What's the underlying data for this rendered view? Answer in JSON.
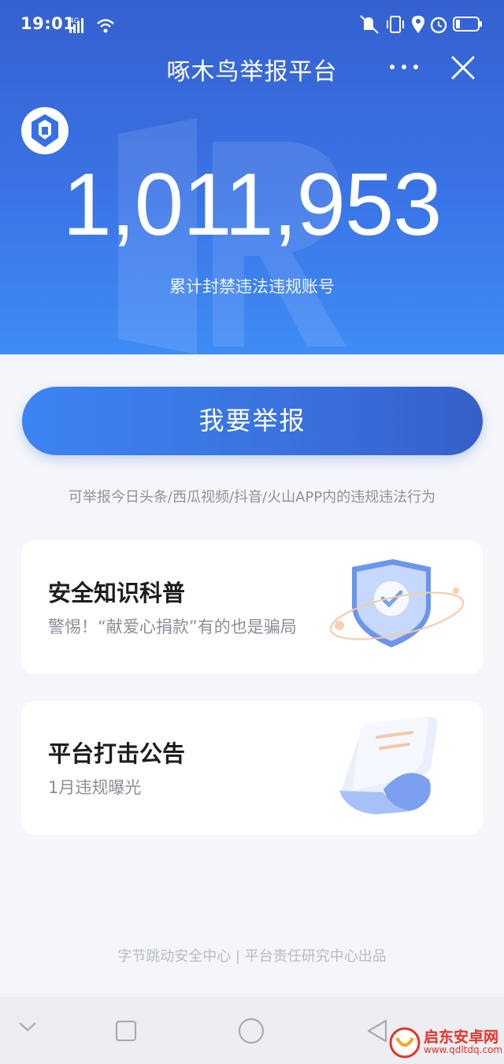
{
  "status_bar": {
    "time": "19:01",
    "network": "4G",
    "icons_left": [
      "signal-icon",
      "wifi-icon"
    ],
    "icons_right": [
      "mute-icon",
      "vibrate-icon",
      "location-icon",
      "alarm-icon",
      "battery-icon"
    ]
  },
  "header": {
    "title": "啄木鸟举报平台",
    "more_icon": "more-dots-icon",
    "close_icon": "close-icon"
  },
  "hero": {
    "count": "1,011,953",
    "count_label": "累计封禁违法违规账号"
  },
  "report": {
    "button_label": "我要举报",
    "note": "可举报今日头条/西瓜视频/抖音/火山APP内的违规违法行为"
  },
  "cards": [
    {
      "title": "安全知识科普",
      "subtitle": "警惕！“献爱心捐款”有的也是骗局",
      "icon": "shield-check-icon"
    },
    {
      "title": "平台打击公告",
      "subtitle": "1月违规曝光",
      "icon": "document-icon"
    }
  ],
  "footer": {
    "text": "字节跳动安全中心 | 平台责任研究中心出品"
  },
  "nav": {
    "items": [
      "back-chevron-icon",
      "recents-square-icon",
      "home-circle-icon",
      "back-triangle-icon"
    ]
  },
  "watermark": {
    "name": "启东安卓网",
    "url": "www.qdltdq.com"
  },
  "colors": {
    "hero_top": "#3560d0",
    "hero_bottom": "#3f8cf6",
    "button": "#3a73df",
    "background": "#f4f6f9"
  }
}
